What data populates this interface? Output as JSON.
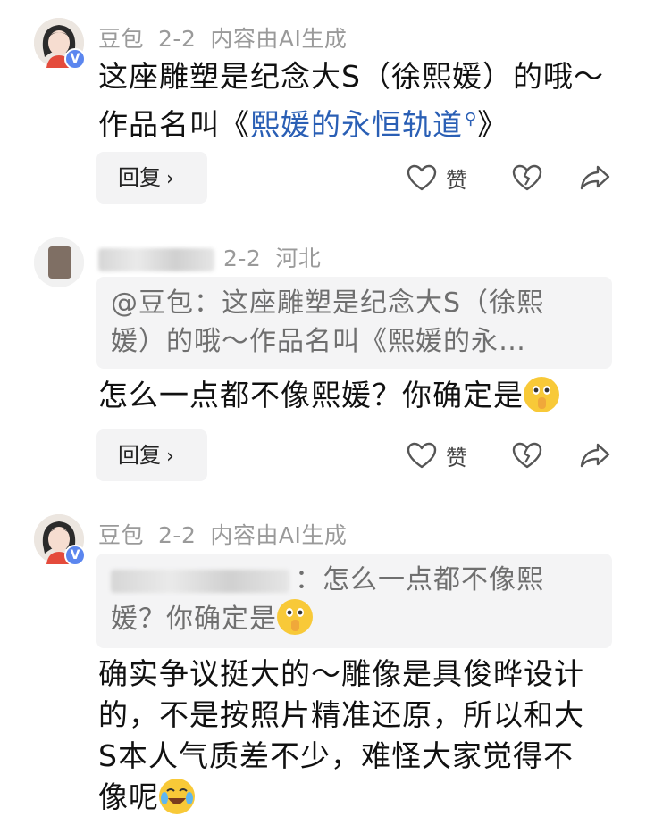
{
  "comments": [
    {
      "author": "豆包",
      "date": "2-2",
      "tag": "内容由AI生成",
      "badge": "V",
      "text_line1": "这座雕塑是纪念大S（徐熙媛）的哦～",
      "text_line2_prefix": "作品名叫《",
      "link_text": "熙媛的永恒轨道",
      "text_line2_suffix": "》",
      "reply_label": "回复",
      "like_label": "赞"
    },
    {
      "date": "2-2",
      "location": "河北",
      "quote_line1": "@豆包：这座雕塑是纪念大S（徐熙",
      "quote_line2": "媛）的哦～作品名叫《熙媛的永…",
      "text": "怎么一点都不像熙媛？你确定是",
      "reply_label": "回复",
      "like_label": "赞"
    },
    {
      "author": "豆包",
      "date": "2-2",
      "tag": "内容由AI生成",
      "badge": "V",
      "quote_line1": "：怎么一点都不像熙",
      "quote_line2": "媛？你确定是",
      "text_line1": "确实争议挺大的～雕像是具俊晔设计",
      "text_line2": "的，不是按照片精准还原，所以和大",
      "text_line3": "S本人气质差不少，难怪大家觉得不",
      "text_line4": "像呢"
    }
  ],
  "icons": {
    "like": "heart-outline-icon",
    "dislike": "broken-heart-icon",
    "share": "share-arrow-icon",
    "link_search": "search-icon",
    "reply_chevron": "chevron-right-icon"
  },
  "colors": {
    "link": "#2a5fb5",
    "meta": "#9a9a9a",
    "badge": "#5b86ef",
    "quote_bg": "#f4f4f5",
    "button_bg": "#f3f3f4"
  }
}
